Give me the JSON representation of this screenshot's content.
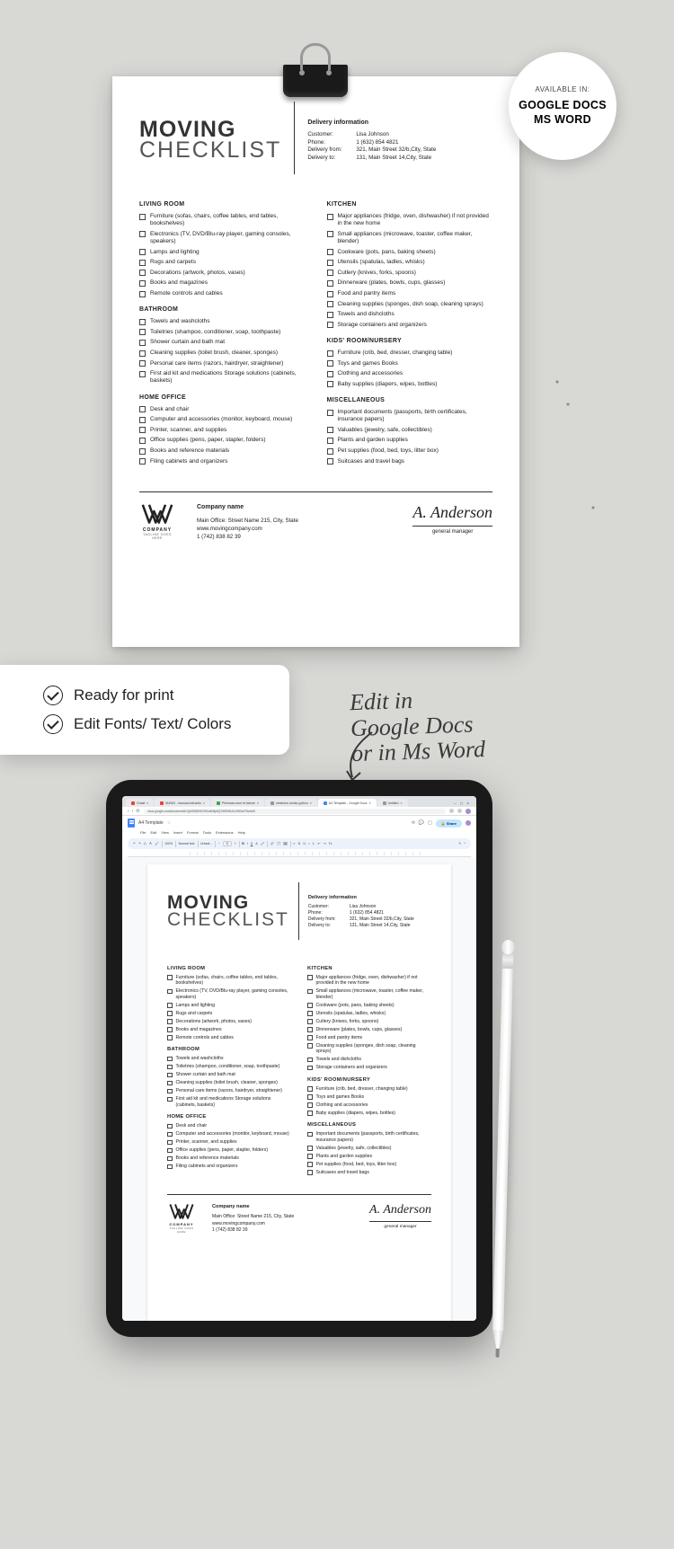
{
  "badge": {
    "line1": "AVAILABLE IN:",
    "line2": "GOOGLE DOCS",
    "line3": "MS WORD"
  },
  "doc": {
    "title1": "MOVING",
    "title2": "CHECKLIST",
    "delivery_heading": "Delivery information",
    "delivery": [
      {
        "k": "Customer:",
        "v": "Lisa Johnson"
      },
      {
        "k": "Phone:",
        "v": "1 (632) 854 4821"
      },
      {
        "k": "Delivery from:",
        "v": "321, Main Street 32/b,City, State"
      },
      {
        "k": "Delivery to:",
        "v": "131, Main Street 14,City, State"
      }
    ],
    "left_sections": [
      {
        "h": "LIVING ROOM",
        "items": [
          "Furniture (sofas, chairs, coffee tables, end tables, bookshelves)",
          "Electronics (TV, DVD/Blu-ray player, gaming consoles, speakers)",
          "Lamps and lighting",
          "Rugs and carpets",
          "Decorations (artwork, photos, vases)",
          "Books and magazines",
          "Remote controls and cables"
        ]
      },
      {
        "h": "BATHROOM",
        "items": [
          "Towels and washcloths",
          "Toiletries (shampoo, conditioner, soap, toothpaste)",
          "Shower curtain and bath mat",
          "Cleaning supplies (toilet brush, cleaner, sponges)",
          "Personal care items (razors, hairdryer, straightener)",
          "First aid kit and medications Storage solutions (cabinets, baskets)"
        ]
      },
      {
        "h": "HOME OFFICE",
        "items": [
          "Desk and chair",
          "Computer and accessories (monitor, keyboard, mouse)",
          "Printer, scanner, and supplies",
          "Office supplies (pens, paper, stapler, folders)",
          "Books and reference materials",
          "Filing cabinets and organizers"
        ]
      }
    ],
    "right_sections": [
      {
        "h": "KITCHEN",
        "items": [
          "Major appliances (fridge, oven, dishwasher) if not provided in the new home",
          "Small appliances (microwave, toaster, coffee maker, blender)",
          "Cookware (pots, pans, baking sheets)",
          "Utensils (spatulas, ladles, whisks)",
          "Cutlery (knives, forks, spoons)",
          "Dinnerware (plates, bowls, cups, glasses)",
          "Food and pantry items",
          "Cleaning supplies (sponges, dish soap, cleaning sprays)",
          "Towels and dishcloths",
          "Storage containers and organizers"
        ]
      },
      {
        "h": "KIDS' ROOM/NURSERY",
        "items": [
          "Furniture (crib, bed, dresser, changing table)",
          "Toys and games Books",
          "Clothing and accessories",
          "Baby supplies (diapers, wipes, bottles)"
        ]
      },
      {
        "h": "MISCELLANEOUS",
        "items": [
          "Important documents (passports, birth certificates, insurance papers)",
          "Valuables (jewelry, safe, collectibles)",
          "Plants and garden supplies",
          "Pet supplies (food, bed, toys, litter box)",
          "Suitcases and travel bags"
        ]
      }
    ],
    "company": {
      "logo_text": "COMPANY",
      "logo_sub": "TAGLINE GOES HERE",
      "name": "Company name",
      "address": "Main Office: Street Name 215, City, State",
      "website": "www.movingcompany.com",
      "phone": "1 (742) 838 82 39"
    },
    "signature": {
      "name": "A. Anderson",
      "role": "general manager"
    }
  },
  "card": {
    "line1": "Ready for print",
    "line2": "Edit Fonts/ Text/ Colors"
  },
  "note": {
    "l1": "Edit in",
    "l2": "Google Docs",
    "l3": "or in Ms Word"
  },
  "browser": {
    "tabs": [
      "Gmail",
      "M4/M3 - manual-extractio",
      "Pitchman eum et labore",
      "minimum works python",
      "A4 Template - Google Docs",
      "Untitled"
    ],
    "url": "docs.google.com/document/d/1Qn5S8D9K2H3m4N5p6Q7r8S9t0U1v2W3x4Y5z/edit",
    "docs": {
      "title": "A4 Template",
      "menu": [
        "File",
        "Edit",
        "View",
        "Insert",
        "Format",
        "Tools",
        "Extensions",
        "Help"
      ],
      "share": "Share",
      "toolbar": {
        "zoom": "100%",
        "style": "Normal text",
        "font": "Urbani...",
        "size": "9"
      }
    }
  }
}
